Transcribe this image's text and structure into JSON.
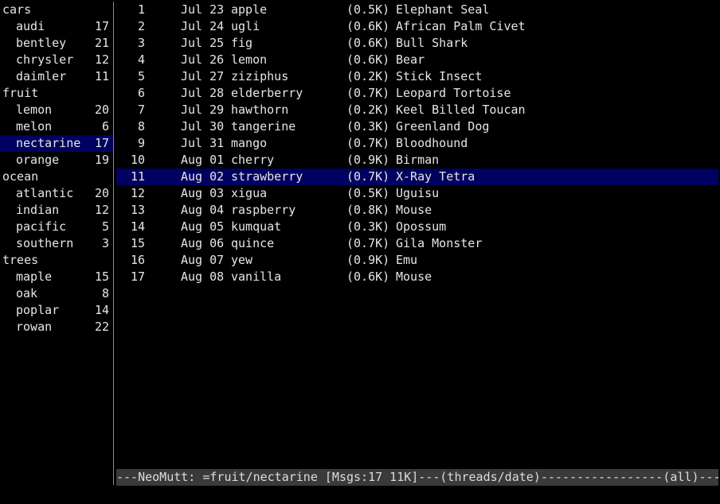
{
  "sidebar": {
    "items": [
      {
        "label": "cars",
        "count": "",
        "level": 0
      },
      {
        "label": "audi",
        "count": "17",
        "level": 1
      },
      {
        "label": "bentley",
        "count": "21",
        "level": 1
      },
      {
        "label": "chrysler",
        "count": "12",
        "level": 1
      },
      {
        "label": "daimler",
        "count": "11",
        "level": 1
      },
      {
        "label": "fruit",
        "count": "",
        "level": 0
      },
      {
        "label": "lemon",
        "count": "20",
        "level": 1
      },
      {
        "label": "melon",
        "count": "6",
        "level": 1
      },
      {
        "label": "nectarine",
        "count": "17",
        "level": 1,
        "selected": true
      },
      {
        "label": "orange",
        "count": "19",
        "level": 1
      },
      {
        "label": "ocean",
        "count": "",
        "level": 0
      },
      {
        "label": "atlantic",
        "count": "20",
        "level": 1
      },
      {
        "label": "indian",
        "count": "12",
        "level": 1
      },
      {
        "label": "pacific",
        "count": "5",
        "level": 1
      },
      {
        "label": "southern",
        "count": "3",
        "level": 1
      },
      {
        "label": "trees",
        "count": "",
        "level": 0
      },
      {
        "label": "maple",
        "count": "15",
        "level": 1
      },
      {
        "label": "oak",
        "count": "8",
        "level": 1
      },
      {
        "label": "poplar",
        "count": "14",
        "level": 1
      },
      {
        "label": "rowan",
        "count": "22",
        "level": 1
      }
    ]
  },
  "index": {
    "messages": [
      {
        "num": "1",
        "date": "Jul 23",
        "from": "apple",
        "size": "(0.5K)",
        "subject": "Elephant Seal"
      },
      {
        "num": "2",
        "date": "Jul 24",
        "from": "ugli",
        "size": "(0.6K)",
        "subject": "African Palm Civet"
      },
      {
        "num": "3",
        "date": "Jul 25",
        "from": "fig",
        "size": "(0.6K)",
        "subject": "Bull Shark"
      },
      {
        "num": "4",
        "date": "Jul 26",
        "from": "lemon",
        "size": "(0.6K)",
        "subject": "Bear"
      },
      {
        "num": "5",
        "date": "Jul 27",
        "from": "ziziphus",
        "size": "(0.2K)",
        "subject": "Stick Insect"
      },
      {
        "num": "6",
        "date": "Jul 28",
        "from": "elderberry",
        "size": "(0.7K)",
        "subject": "Leopard Tortoise"
      },
      {
        "num": "7",
        "date": "Jul 29",
        "from": "hawthorn",
        "size": "(0.2K)",
        "subject": "Keel Billed Toucan"
      },
      {
        "num": "8",
        "date": "Jul 30",
        "from": "tangerine",
        "size": "(0.3K)",
        "subject": "Greenland Dog"
      },
      {
        "num": "9",
        "date": "Jul 31",
        "from": "mango",
        "size": "(0.7K)",
        "subject": "Bloodhound"
      },
      {
        "num": "10",
        "date": "Aug 01",
        "from": "cherry",
        "size": "(0.9K)",
        "subject": "Birman"
      },
      {
        "num": "11",
        "date": "Aug 02",
        "from": "strawberry",
        "size": "(0.7K)",
        "subject": "X-Ray Tetra",
        "selected": true
      },
      {
        "num": "12",
        "date": "Aug 03",
        "from": "xigua",
        "size": "(0.5K)",
        "subject": "Uguisu"
      },
      {
        "num": "13",
        "date": "Aug 04",
        "from": "raspberry",
        "size": "(0.8K)",
        "subject": "Mouse"
      },
      {
        "num": "14",
        "date": "Aug 05",
        "from": "kumquat",
        "size": "(0.3K)",
        "subject": "Opossum"
      },
      {
        "num": "15",
        "date": "Aug 06",
        "from": "quince",
        "size": "(0.7K)",
        "subject": "Gila Monster"
      },
      {
        "num": "16",
        "date": "Aug 07",
        "from": "yew",
        "size": "(0.9K)",
        "subject": "Emu"
      },
      {
        "num": "17",
        "date": "Aug 08",
        "from": "vanilla",
        "size": "(0.6K)",
        "subject": "Mouse"
      }
    ]
  },
  "status_bar": {
    "text": "---NeoMutt: =fruit/nectarine [Msgs:17 11K]---(threads/date)-----------------(all)---"
  },
  "colors": {
    "background": "#000000",
    "foreground": "#e6e6e6",
    "selection": "#000060",
    "status_bar": "#3a3a3a",
    "divider": "#8a8a8a"
  }
}
